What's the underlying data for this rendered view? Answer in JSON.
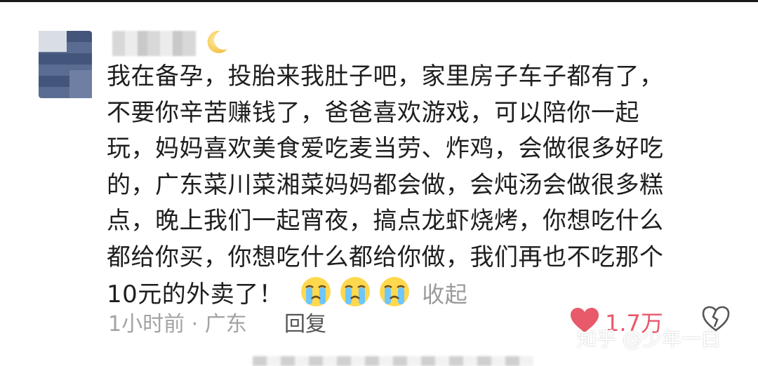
{
  "comment": {
    "lines": [
      "我在备孕，投胎来我肚子吧，家里房子车子都有了，",
      "不要你辛苦赚钱了，爸爸喜欢游戏，可以陪你一起",
      "玩，妈妈喜欢美食爱吃麦当劳、炸鸡，会做很多好吃",
      "的，广东菜川菜湘菜妈妈都会做，会炖汤会做很多糕",
      "点，晚上我们一起宵夜，搞点龙虾烧烤，你想吃什么",
      "都给你买，你想吃什么都给你做，我们再也不吃那个",
      "10元的外卖了！"
    ],
    "emoji": [
      "crying-face-icon",
      "crying-face-icon",
      "crying-face-icon"
    ],
    "collapse_label": "收起"
  },
  "meta": {
    "time_location": "1小时前 · 广东",
    "reply_label": "回复",
    "like_count": "1.7万"
  },
  "watermark": "知乎 @少年一白",
  "colors": {
    "like": "#e8596a",
    "text": "#1e1e1e",
    "muted": "#a3a3a3"
  }
}
